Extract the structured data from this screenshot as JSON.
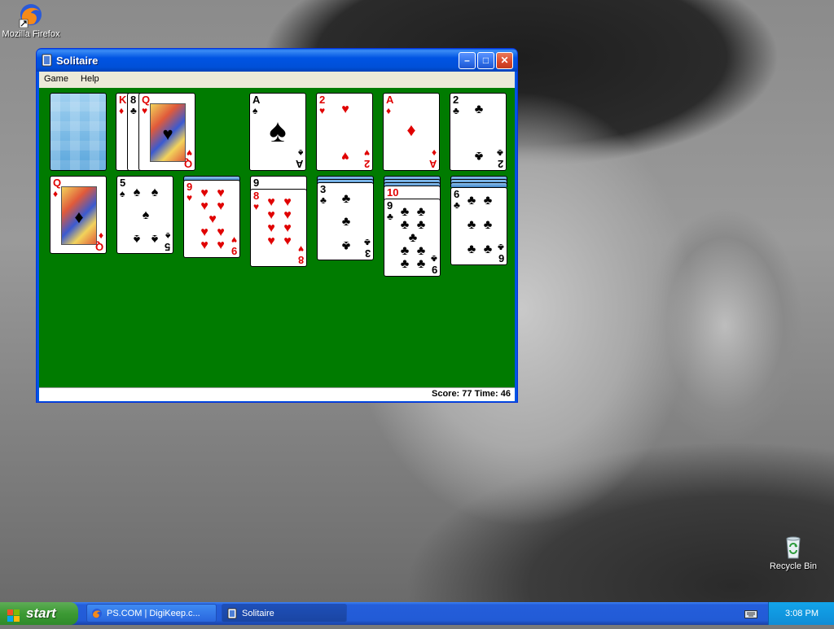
{
  "desktop": {
    "icons": [
      {
        "label": "Mozilla Firefox",
        "icon": "firefox-icon"
      },
      {
        "label": "Recycle Bin",
        "icon": "recycle-bin-icon"
      }
    ]
  },
  "window": {
    "title": "Solitaire",
    "menu": [
      "Game",
      "Help"
    ],
    "status": "Score: 77 Time: 46"
  },
  "game": {
    "stock": {
      "face_down": true
    },
    "waste": [
      {
        "rank": "K",
        "suit": "♦"
      },
      {
        "rank": "8",
        "suit": "♣"
      },
      {
        "rank": "Q",
        "suit": "♥"
      }
    ],
    "foundations": [
      {
        "rank": "A",
        "suit": "♠"
      },
      {
        "rank": "2",
        "suit": "♥"
      },
      {
        "rank": "A",
        "suit": "♦"
      },
      {
        "rank": "2",
        "suit": "♣"
      }
    ],
    "tableau": [
      {
        "hidden": 0,
        "cards": [
          {
            "rank": "Q",
            "suit": "♦"
          }
        ]
      },
      {
        "hidden": 0,
        "cards": [
          {
            "rank": "5",
            "suit": "♠"
          }
        ]
      },
      {
        "hidden": 1,
        "cards": [
          {
            "rank": "9",
            "suit": "♥"
          }
        ]
      },
      {
        "hidden": 0,
        "cards": [
          {
            "rank": "9",
            "suit": "♠"
          },
          {
            "rank": "8",
            "suit": "♥"
          }
        ]
      },
      {
        "hidden": 2,
        "cards": [
          {
            "rank": "3",
            "suit": "♣"
          }
        ]
      },
      {
        "hidden": 3,
        "cards": [
          {
            "rank": "10",
            "suit": "♥"
          },
          {
            "rank": "9",
            "suit": "♣"
          }
        ]
      },
      {
        "hidden": 3,
        "cards": [
          {
            "rank": "6",
            "suit": "♣"
          }
        ]
      }
    ]
  },
  "taskbar": {
    "start_label": "start",
    "tasks": [
      {
        "label": "PS.COM | DigiKeep.c...",
        "icon": "firefox-icon"
      },
      {
        "label": "Solitaire",
        "icon": "solitaire-icon"
      }
    ],
    "clock": "3:08 PM"
  },
  "colors": {
    "felt": "#007b00",
    "title_bar": "#0054e3",
    "taskbar": "#245edb",
    "start": "#3c9a34"
  }
}
